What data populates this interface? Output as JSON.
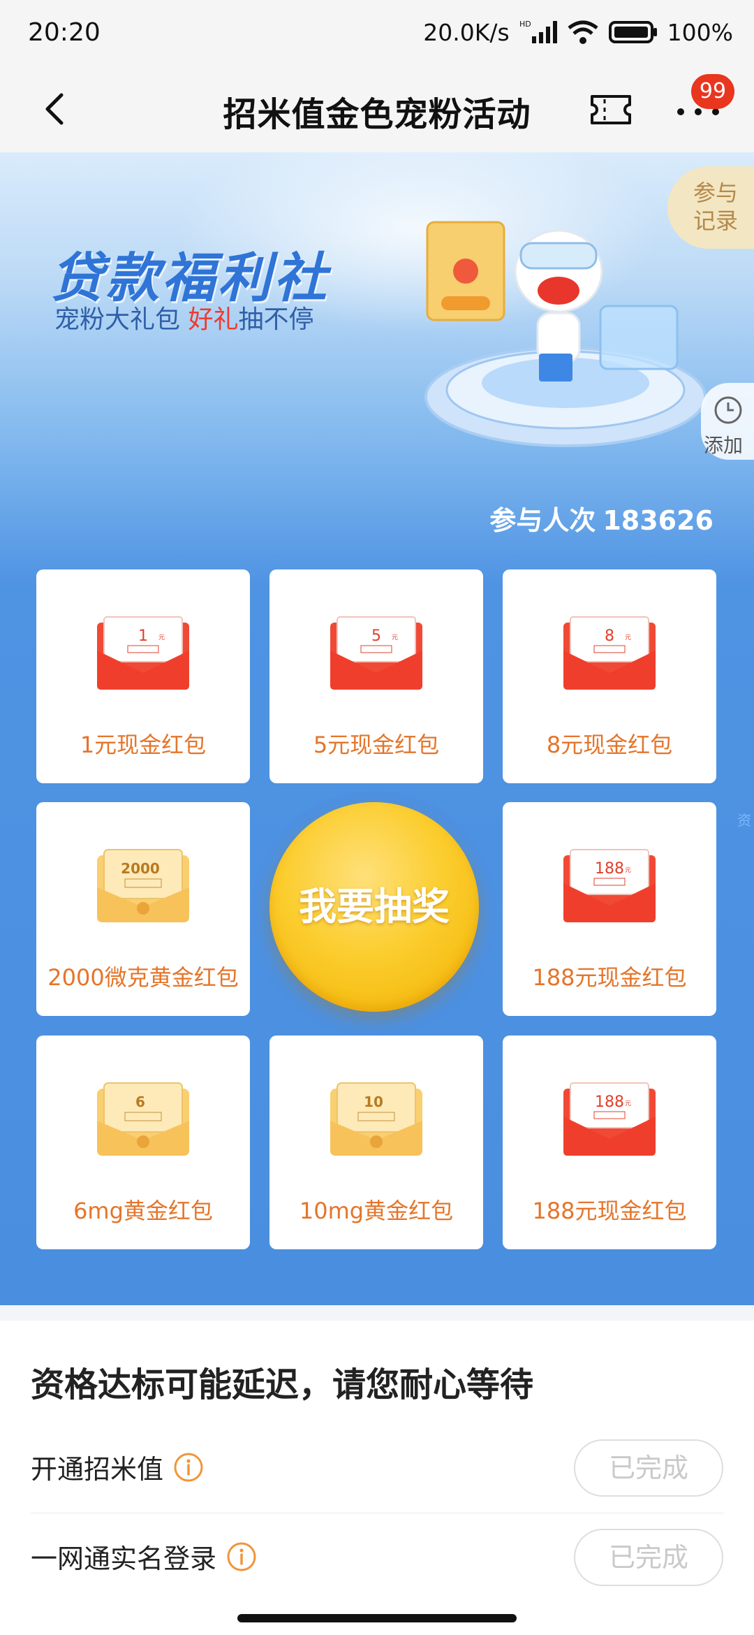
{
  "status_bar": {
    "time": "20:20",
    "network_speed": "20.0K/s",
    "battery": "100%",
    "icons": [
      "hd-signal-icon",
      "wifi-icon",
      "battery-icon"
    ]
  },
  "nav": {
    "title": "招米值金色宠粉活动",
    "badge_count": "99",
    "icons": [
      "back-arrow-icon",
      "ticket-icon",
      "more-dots-icon"
    ]
  },
  "banner": {
    "title": "贷款福利社",
    "subtitle_prefix": "宠粉大礼包 ",
    "subtitle_highlight": "好礼",
    "subtitle_suffix": "抽不停",
    "join_record_label_line1": "参与",
    "join_record_label_line2": "记录",
    "add_widget_label": "添加",
    "participants_label": "参与人次",
    "participants_count": "183626"
  },
  "prizes": [
    {
      "label": "1元现金红包",
      "amount": "1",
      "kind": "cash"
    },
    {
      "label": "5元现金红包",
      "amount": "5",
      "kind": "cash"
    },
    {
      "label": "8元现金红包",
      "amount": "8",
      "kind": "cash"
    },
    {
      "label": "2000微克黄金红包",
      "amount": "2000",
      "kind": "gold"
    },
    {
      "label": "188元现金红包",
      "amount": "188",
      "kind": "cash"
    },
    {
      "label": "6mg黄金红包",
      "amount": "6",
      "kind": "gold"
    },
    {
      "label": "10mg黄金红包",
      "amount": "10",
      "kind": "gold"
    },
    {
      "label": "188元现金红包",
      "amount": "188",
      "kind": "cash"
    }
  ],
  "draw_button_label": "我要抽奖",
  "tasks": {
    "title": "资格达标可能延迟，请您耐心等待",
    "items": [
      {
        "label": "开通招米值",
        "status": "已完成"
      },
      {
        "label": "一网通实名登录",
        "status": "已完成"
      }
    ]
  },
  "colors": {
    "accent_orange": "#e4752a",
    "brand_blue": "#4a8ee0",
    "badge_red": "#e8361f",
    "draw_gold": "#fbcd2e"
  }
}
